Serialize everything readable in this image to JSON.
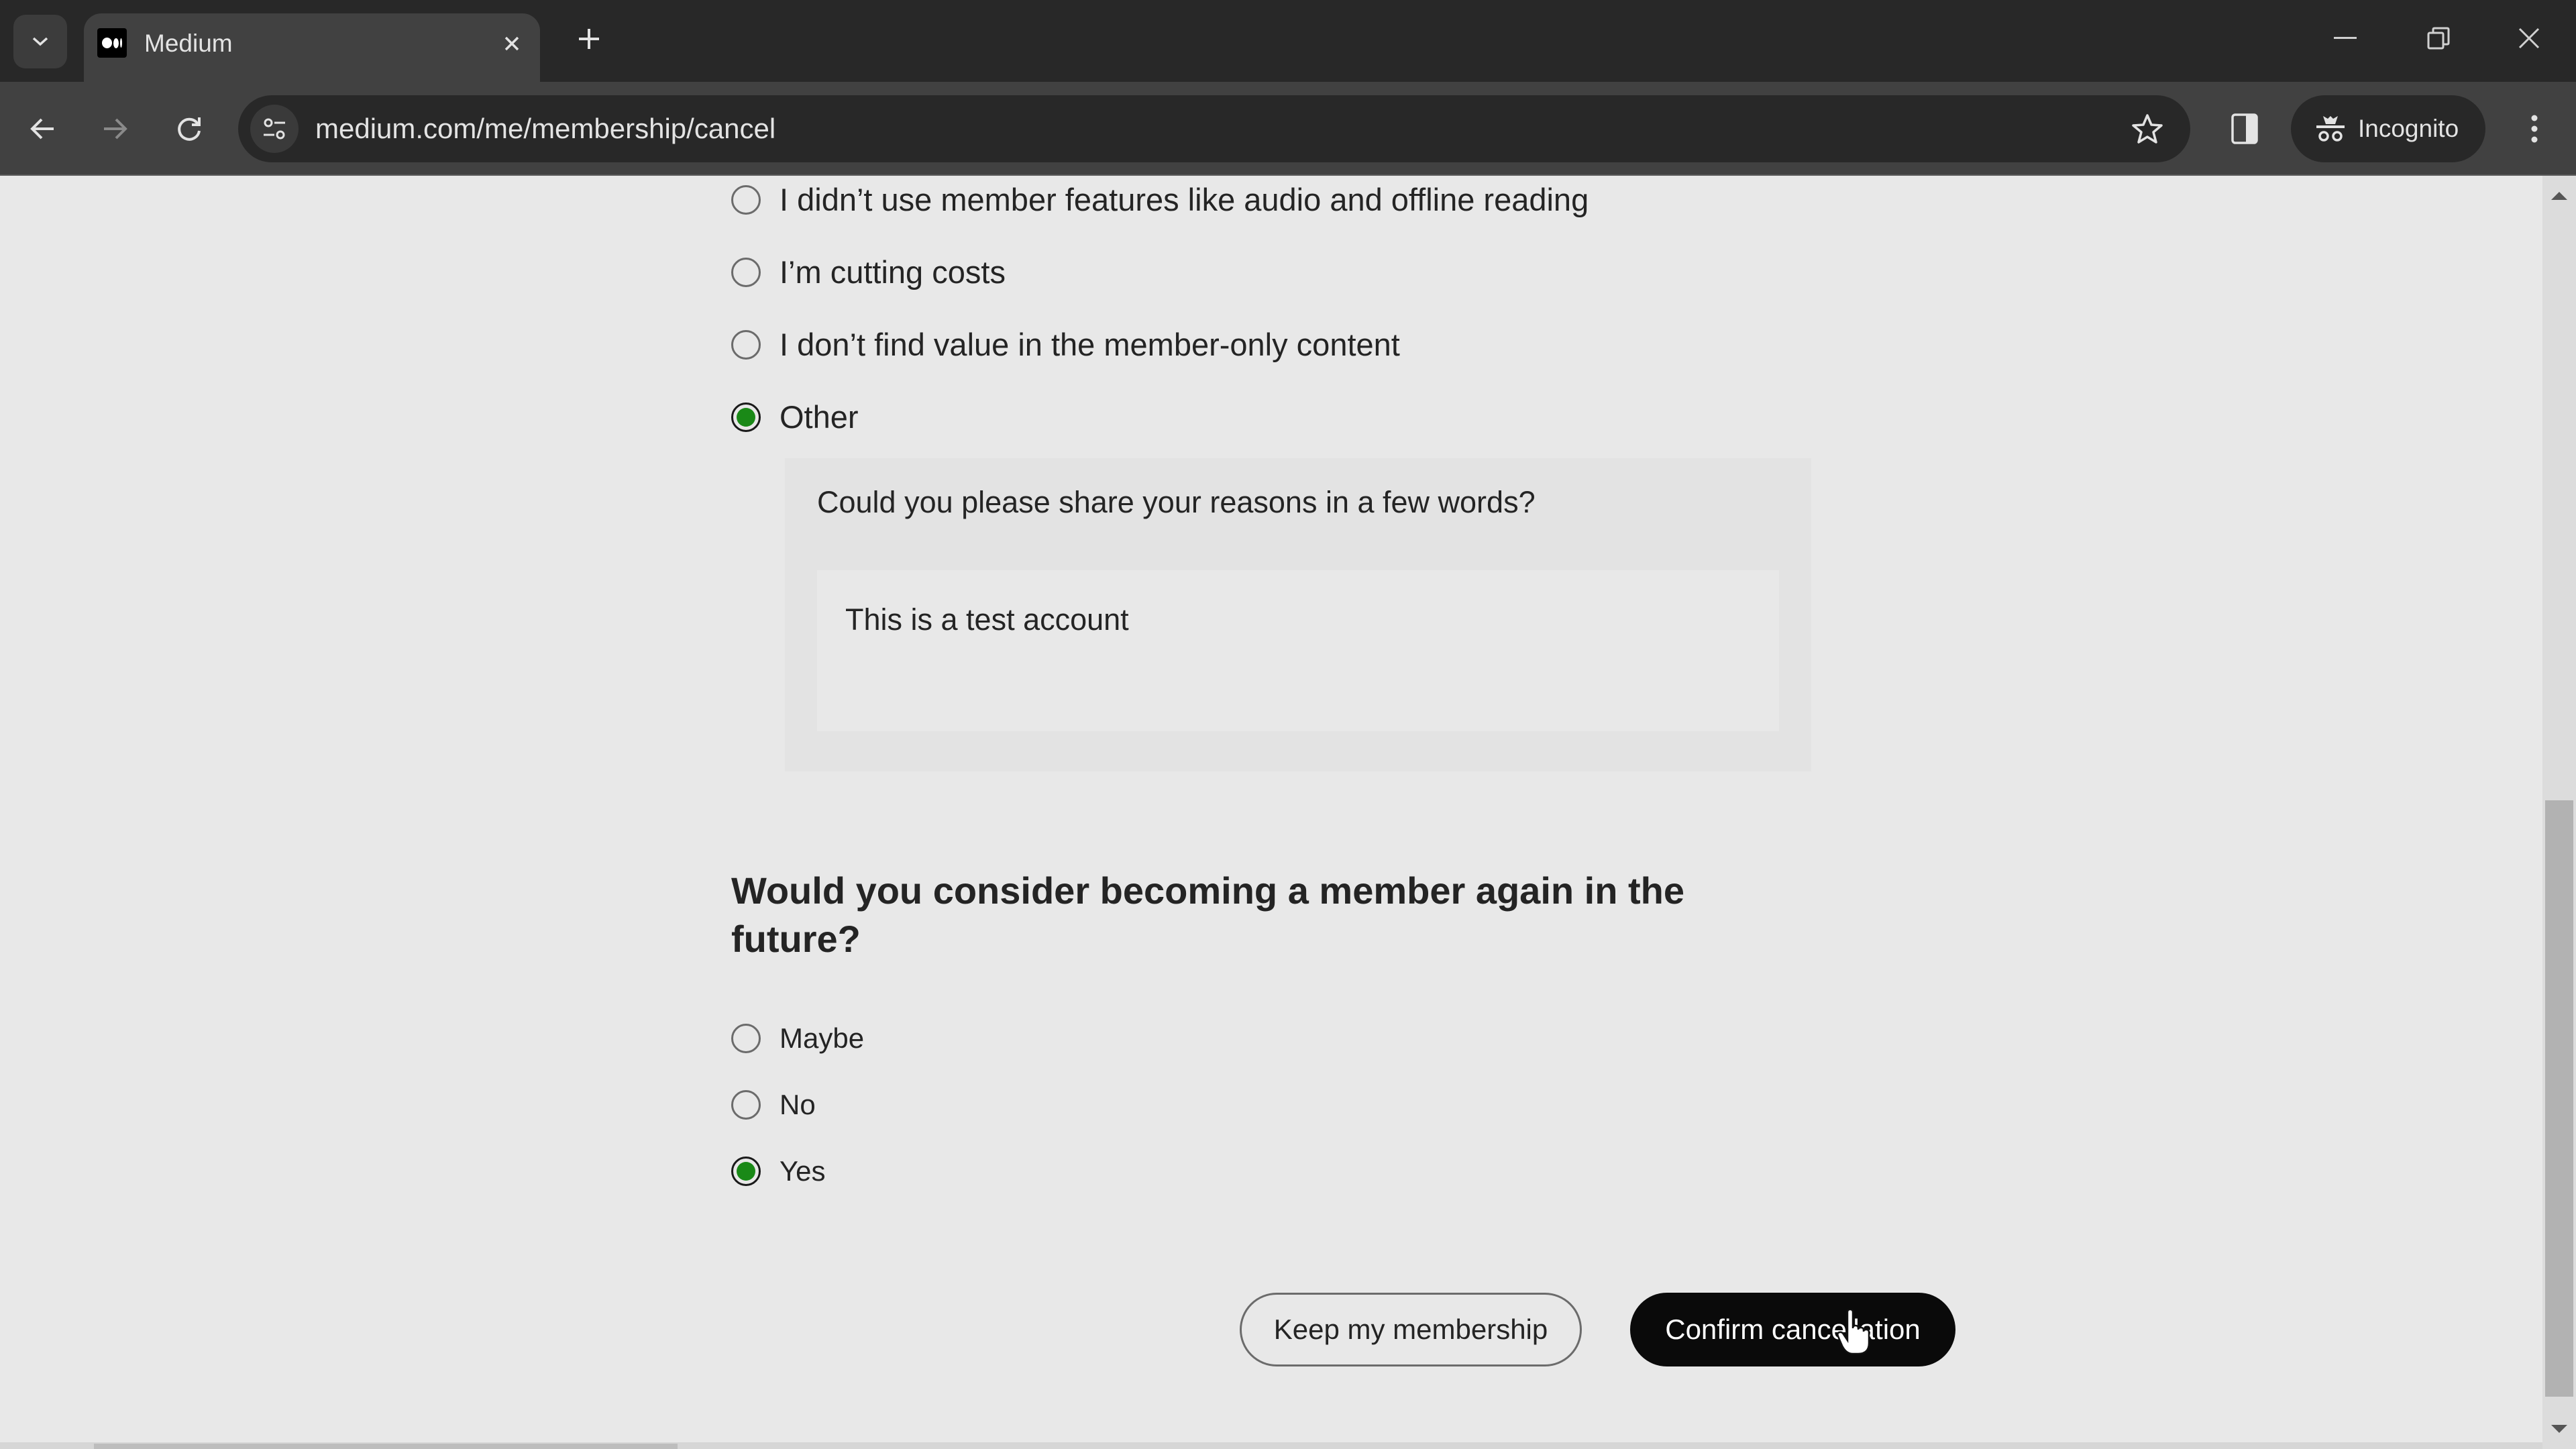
{
  "browser": {
    "tab": {
      "title": "Medium",
      "favicon": "medium-logo"
    },
    "url": "medium.com/me/membership/cancel",
    "incognito_label": "Incognito",
    "icons": {
      "tab_search": "chevron-down-icon",
      "tab_close": "close-icon",
      "new_tab": "plus-icon",
      "minimize": "minimize-icon",
      "restore": "restore-icon",
      "window_close": "close-icon",
      "back": "arrow-left-icon",
      "forward": "arrow-right-icon",
      "reload": "reload-icon",
      "site_info": "tune-icon",
      "bookmark": "star-icon",
      "side_panel": "side-panel-icon",
      "incognito": "incognito-icon",
      "menu": "kebab-menu-icon"
    }
  },
  "page": {
    "reason_options": [
      {
        "label": "I didn’t use member features like audio and offline reading",
        "checked": false
      },
      {
        "label": "I’m cutting costs",
        "checked": false
      },
      {
        "label": "I don’t find value in the member-only content",
        "checked": false
      },
      {
        "label": "Other",
        "checked": true
      }
    ],
    "other_reason": {
      "prompt": "Could you please share your reasons in a few words?",
      "value": "This is a test account"
    },
    "future_question": "Would you consider becoming a member again in the future?",
    "future_options": [
      {
        "label": "Maybe",
        "checked": false
      },
      {
        "label": "No",
        "checked": false
      },
      {
        "label": "Yes",
        "checked": true
      }
    ],
    "buttons": {
      "keep": "Keep my membership",
      "confirm": "Confirm cancellation"
    },
    "accent_color": "#1a8917"
  },
  "scrollbar": {
    "position_fraction": 0.98,
    "visible_fraction": 0.5
  }
}
